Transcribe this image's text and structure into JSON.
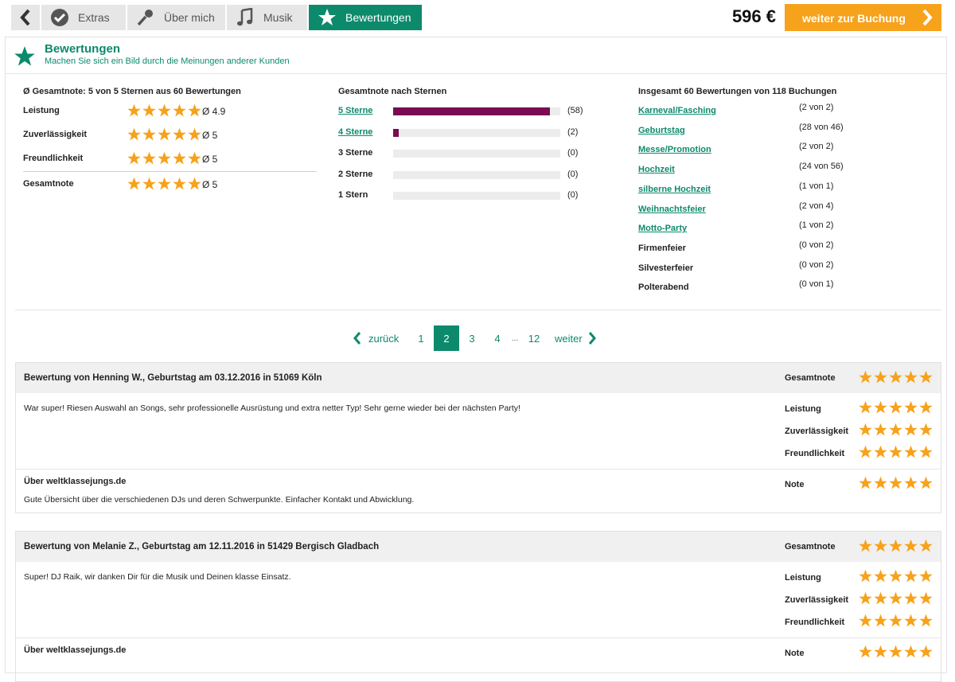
{
  "nav": {
    "tabs": [
      {
        "label": "Extras",
        "icon": "check-badge-icon"
      },
      {
        "label": "Über mich",
        "icon": "microphone-icon"
      },
      {
        "label": "Musik",
        "icon": "music-note-icon"
      },
      {
        "label": "Bewertungen",
        "icon": "star-icon"
      }
    ],
    "price": "596 €",
    "book_label": "weiter zur Buchung"
  },
  "colors": {
    "accent": "#0d8a6c",
    "star": "#f7a21b",
    "bar": "#7a0a52",
    "book": "#f7a21b"
  },
  "header": {
    "title": "Bewertungen",
    "subtitle": "Machen Sie sich ein Bild durch die Meinungen anderer Kunden"
  },
  "summary": {
    "title": "Ø Gesamtnote: 5 von 5 Sternen aus 60 Bewertungen",
    "rows": [
      {
        "label": "Leistung",
        "stars": 5,
        "avg": "Ø 4.9"
      },
      {
        "label": "Zuverlässigkeit",
        "stars": 5,
        "avg": "Ø 5"
      },
      {
        "label": "Freundlichkeit",
        "stars": 5,
        "avg": "Ø 5"
      },
      {
        "label": "Gesamtnote",
        "stars": 5,
        "avg": "Ø 5"
      }
    ]
  },
  "distribution": {
    "title": "Gesamtnote nach Sternen",
    "rows": [
      {
        "label": "5 Sterne",
        "count": "(58)",
        "value": 58
      },
      {
        "label": "4 Sterne",
        "count": "(2)",
        "value": 2
      },
      {
        "label": "3 Sterne",
        "count": "(0)",
        "value": 0
      },
      {
        "label": "2 Sterne",
        "count": "(0)",
        "value": 0
      },
      {
        "label": "1 Stern",
        "count": "(0)",
        "value": 0
      }
    ],
    "total": 60
  },
  "occasions": {
    "title": "Insgesamt 60 Bewertungen von 118 Buchungen",
    "rows": [
      {
        "label": "Karneval/Fasching",
        "value": "(2 von 2)"
      },
      {
        "label": "Geburtstag",
        "value": "(28 von 46)"
      },
      {
        "label": "Messe/Promotion",
        "value": "(2 von 2)"
      },
      {
        "label": "Hochzeit",
        "value": "(24 von 56)"
      },
      {
        "label": "silberne Hochzeit",
        "value": "(1 von 1)"
      },
      {
        "label": "Weihnachtsfeier",
        "value": "(2 von 4)"
      },
      {
        "label": "Motto-Party",
        "value": "(1 von 2)"
      },
      {
        "label": "Firmenfeier",
        "value": "(0 von 2)"
      },
      {
        "label": "Silvesterfeier",
        "value": "(0 von 2)"
      },
      {
        "label": "Polterabend",
        "value": "(0 von 1)"
      }
    ]
  },
  "pagination": {
    "prev": "zurück",
    "next": "weiter",
    "pages": [
      "1",
      "2",
      "3",
      "4",
      "...",
      "12"
    ],
    "current": "2"
  },
  "reviews": [
    {
      "title": "Bewertung von Henning W., Geburtstag am 03.12.2016 in 51069 Köln",
      "overall_label": "Gesamtnote",
      "text": "War super! Riesen Auswahl an Songs, sehr professionelle Ausrüstung und extra netter Typ! Sehr gerne wieder bei der nächsten Party!",
      "ratings": [
        {
          "label": "Leistung",
          "stars": 5
        },
        {
          "label": "Zuverlässigkeit",
          "stars": 5
        },
        {
          "label": "Freundlichkeit",
          "stars": 5
        }
      ],
      "site_title": "Über weltklassejungs.de",
      "site_text": "Gute Übersicht über die verschiedenen DJs und deren Schwerpunkte. Einfacher Kontakt und Abwicklung.",
      "note_label": "Note"
    },
    {
      "title": "Bewertung von Melanie Z., Geburtstag am 12.11.2016 in 51429 Bergisch Gladbach",
      "overall_label": "Gesamtnote",
      "text": "Super! DJ Raik, wir danken Dir für die Musik und Deinen klasse Einsatz.",
      "ratings": [
        {
          "label": "Leistung",
          "stars": 5
        },
        {
          "label": "Zuverlässigkeit",
          "stars": 5
        },
        {
          "label": "Freundlichkeit",
          "stars": 5
        }
      ],
      "site_title": "Über weltklassejungs.de",
      "site_text": "",
      "note_label": "Note"
    }
  ]
}
